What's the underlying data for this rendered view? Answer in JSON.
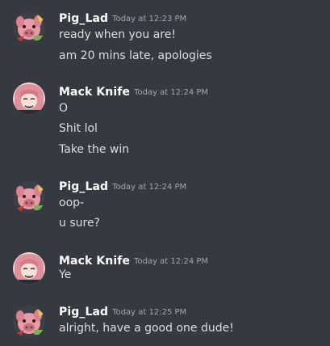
{
  "messages": [
    {
      "author": "Pig_Lad",
      "avatar_icon": "pig-lad-avatar",
      "timestamp": "Today at 12:23 PM",
      "lines": [
        "ready when you are!",
        "am 20 mins late, apologies"
      ]
    },
    {
      "author": "Mack Knife",
      "avatar_icon": "mack-knife-avatar",
      "timestamp": "Today at 12:24 PM",
      "lines": [
        "O",
        "Shit lol",
        "Take the win"
      ]
    },
    {
      "author": "Pig_Lad",
      "avatar_icon": "pig-lad-avatar",
      "timestamp": "Today at 12:24 PM",
      "lines": [
        "oop-",
        "u sure?"
      ]
    },
    {
      "author": "Mack Knife",
      "avatar_icon": "mack-knife-avatar",
      "timestamp": "Today at 12:24 PM",
      "lines": [
        "Ye"
      ]
    },
    {
      "author": "Pig_Lad",
      "avatar_icon": "pig-lad-avatar",
      "timestamp": "Today at 12:25 PM",
      "lines": [
        "alright, have a good one dude!"
      ]
    }
  ],
  "colors": {
    "background": "#36393f",
    "username": "#ffffff",
    "timestamp": "#a3a6aa",
    "message_text": "#dcddde"
  }
}
